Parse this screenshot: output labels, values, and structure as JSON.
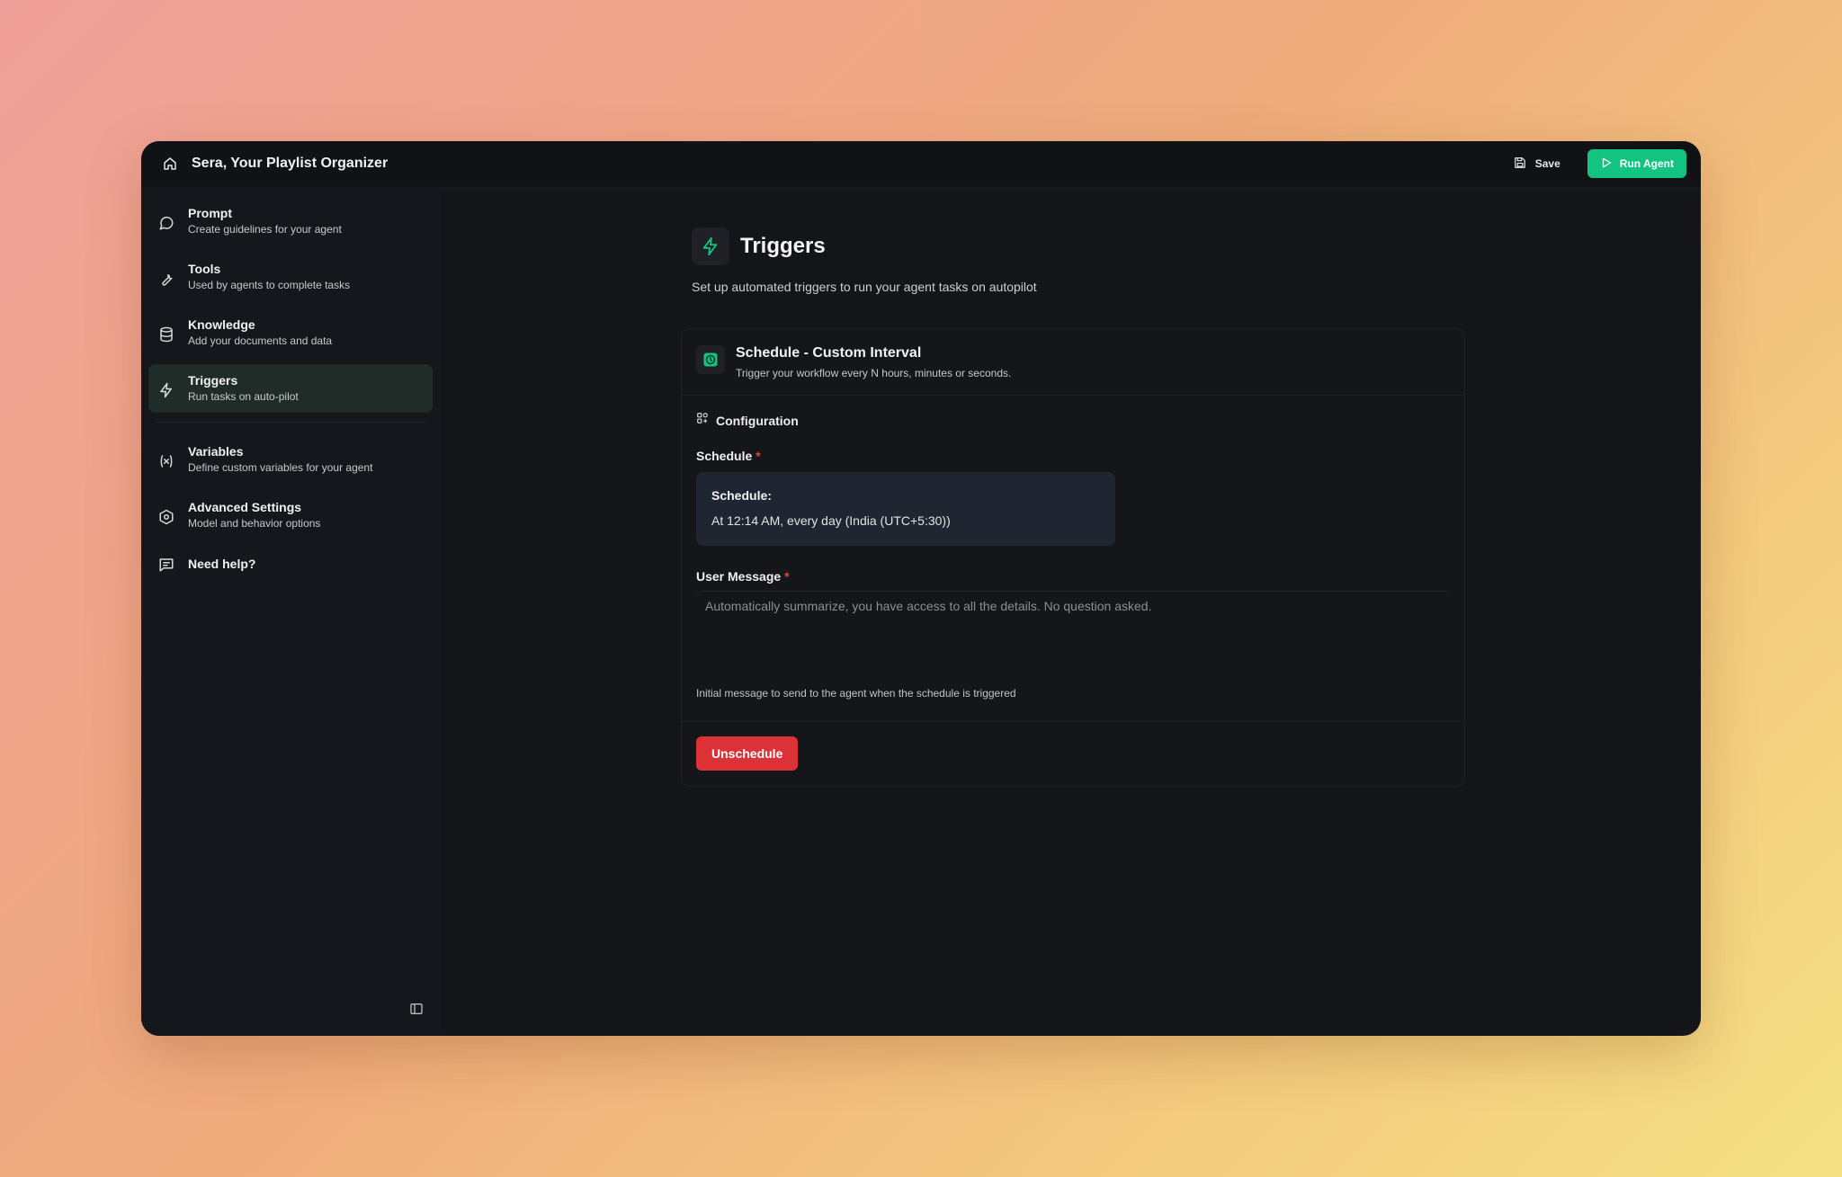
{
  "topbar": {
    "title": "Sera, Your Playlist Organizer",
    "save_label": "Save",
    "run_label": "Run Agent"
  },
  "sidebar": {
    "items": [
      {
        "label": "Prompt",
        "sub": "Create guidelines for your agent",
        "icon": "chat-bubble-icon"
      },
      {
        "label": "Tools",
        "sub": "Used by agents to complete tasks",
        "icon": "wrench-icon"
      },
      {
        "label": "Knowledge",
        "sub": "Add your documents and data",
        "icon": "database-icon"
      },
      {
        "label": "Triggers",
        "sub": "Run tasks on auto-pilot",
        "icon": "lightning-icon"
      },
      {
        "label": "Variables",
        "sub": "Define custom variables for your agent",
        "icon": "variable-icon"
      },
      {
        "label": "Advanced Settings",
        "sub": "Model and behavior options",
        "icon": "hexagon-settings-icon"
      },
      {
        "label": "Need help?",
        "icon": "message-square-icon"
      }
    ],
    "active": "Triggers"
  },
  "main": {
    "title": "Triggers",
    "subtitle": "Set up automated triggers to run your agent tasks on autopilot",
    "card": {
      "title": "Schedule - Custom Interval",
      "subtitle": "Trigger your workflow every N hours, minutes or seconds.",
      "config_label": "Configuration",
      "schedule_label": "Schedule",
      "required_mark": "*",
      "schedule_heading": "Schedule:",
      "schedule_value": "At 12:14 AM, every day (India (UTC+5:30))",
      "message_label": "User Message",
      "message_placeholder": "Automatically summarize, you have access to all the details. No question asked.",
      "message_help": "Initial message to send to the agent when the schedule is triggered",
      "unschedule_label": "Unschedule"
    }
  },
  "colors": {
    "accent_green": "#12c47f",
    "danger_red": "#dc3137",
    "active_nav_bg": "#1f2c27"
  }
}
